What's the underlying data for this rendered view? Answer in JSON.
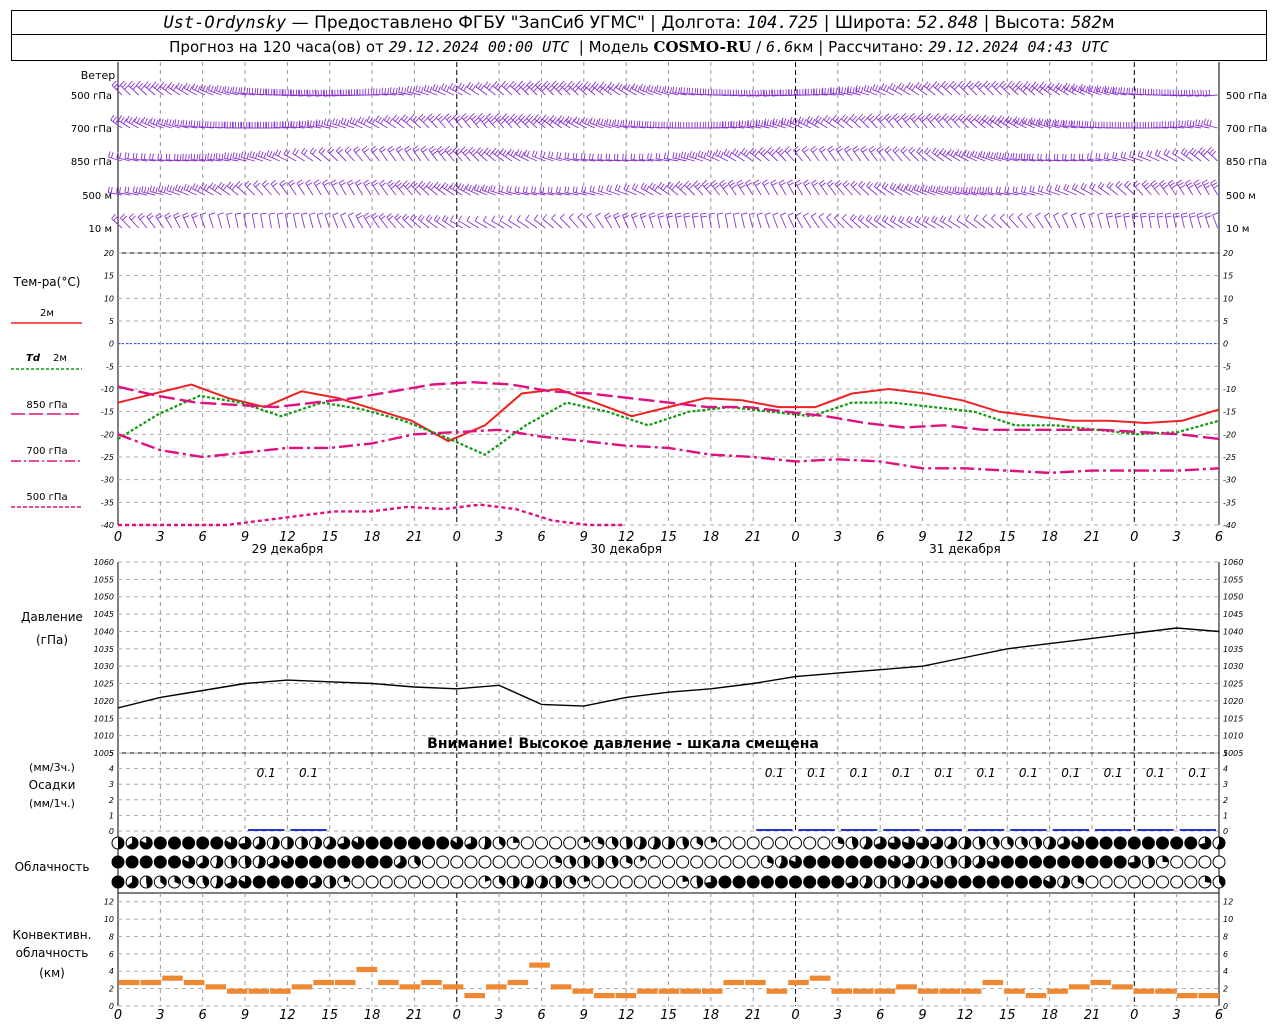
{
  "header": {
    "station": "Ust-Ordynsky",
    "provided_by": "Предоставлено ФГБУ \"ЗапСиб УГМС\"",
    "lon_label": "Долгота:",
    "lon": "104.725",
    "lat_label": "Широта:",
    "lat": "52.848",
    "alt_label": "Высота:",
    "alt": "582",
    "alt_unit": "м",
    "forecast_label": "Прогноз на 120 часа(ов) от",
    "forecast_time": "29.12.2024 00:00 UTC",
    "model_label": "Модель",
    "model": "COSMO-RU",
    "resolution": "6.6",
    "resolution_unit": "км",
    "computed_label": "Рассчитано:",
    "computed_time": "29.12.2024 04:43 UTC"
  },
  "labels": {
    "wind": "Ветер",
    "wind_levels": [
      "500 гПа",
      "700 гПа",
      "850 гПа",
      "500 м",
      "10  м"
    ],
    "temp_title": "Тем-ра(°С)",
    "t2m": "2м",
    "td_sym": "Td",
    "td2m": "2м",
    "t850": "850 гПа",
    "t700": "700 гПа",
    "t500": "500 гПа",
    "pressure": "Давление",
    "pressure_unit": "(гПа)",
    "pressure_warning": "Внимание! Высокое давление - шкала смещена",
    "precip_unit3": "(мм/3ч.)",
    "precip": "Осадки",
    "precip_unit1": "(мм/1ч.)",
    "cloud": "Облачность",
    "conv1": "Конвективн.",
    "conv2": "облачность",
    "conv3": "(км)"
  },
  "colors": {
    "t2m": "#ee2222",
    "td2m": "#119911",
    "upper_temp": "#e01080",
    "zero_line": "#3344ff",
    "wind": "#8833cc",
    "precip": "#2233cc",
    "convective": "#ee8833"
  },
  "chart_data": {
    "type": "line",
    "x_hours_from_start": [
      0,
      3,
      6,
      9,
      12,
      15,
      18,
      21,
      24,
      27,
      30,
      33,
      36,
      39,
      42,
      45,
      48,
      51,
      54,
      57,
      60,
      63,
      66,
      69,
      72,
      75,
      78
    ],
    "x_tick_labels": [
      "0",
      "3",
      "6",
      "9",
      "12",
      "15",
      "18",
      "21",
      "0",
      "3",
      "6",
      "9",
      "12",
      "15",
      "18",
      "21",
      "0",
      "3",
      "6",
      "9",
      "12",
      "15",
      "18",
      "21",
      "0",
      "3",
      "6"
    ],
    "date_labels": [
      "29 декабря",
      "30 декабря",
      "31 декабря"
    ],
    "temperature": {
      "ylim": [
        -40,
        20
      ],
      "yticks": [
        20,
        15,
        10,
        5,
        0,
        -5,
        -10,
        -15,
        -20,
        -25,
        -30,
        -35,
        -40
      ],
      "series": [
        {
          "name": "2м",
          "values": [
            -13,
            -11,
            -9,
            -12,
            -14,
            -10.5,
            -12,
            -14.5,
            -17,
            -21.5,
            -18,
            -11,
            -10,
            -13,
            -16,
            -14,
            -12,
            -12.5,
            -14,
            -14,
            -11,
            -10,
            -11,
            -12.5,
            -15,
            -16,
            -17,
            -17,
            -17.5,
            -17,
            -14.5
          ]
        },
        {
          "name": "Td 2м",
          "values": [
            -21,
            -15.5,
            -11.5,
            -13,
            -16,
            -13,
            -14.5,
            -17,
            -20.5,
            -24.5,
            -18,
            -13,
            -15,
            -18,
            -15,
            -14,
            -15,
            -16,
            -13,
            -13,
            -14,
            -15,
            -18,
            -18,
            -19,
            -20,
            -19.5,
            -17
          ]
        },
        {
          "name": "850 гПа",
          "values": [
            -9.5,
            -11.5,
            -13,
            -13.5,
            -14,
            -13,
            -12,
            -10.5,
            -9,
            -8.5,
            -9,
            -10.5,
            -11,
            -12,
            -13,
            -14,
            -14,
            -15,
            -16,
            -17.5,
            -18.5,
            -18,
            -19,
            -19,
            -19,
            -19,
            -19.5,
            -20,
            -21
          ]
        },
        {
          "name": "700 гПа",
          "values": [
            -20,
            -23.5,
            -25,
            -24,
            -23,
            -23,
            -22,
            -20,
            -19.5,
            -19,
            -20.5,
            -21.5,
            -22.5,
            -23,
            -24.5,
            -25,
            -26,
            -25.5,
            -26,
            -27.5,
            -27.5,
            -28,
            -28.5,
            -28,
            -28,
            -28,
            -27.5
          ]
        },
        {
          "name": "500 гПа",
          "values": [
            -40,
            -40.5,
            -41,
            -40,
            -39,
            -38,
            -37,
            -37,
            -36,
            -36.5,
            -35.5,
            -36.5,
            -39,
            -40,
            -41
          ]
        }
      ]
    },
    "pressure": {
      "ylim": [
        1005,
        1060
      ],
      "yticks": [
        1060,
        1055,
        1050,
        1045,
        1040,
        1035,
        1030,
        1025,
        1020,
        1015,
        1010,
        1005
      ],
      "values": [
        1018,
        1021,
        1023,
        1025,
        1026,
        1025.5,
        1025,
        1024,
        1023.5,
        1024.5,
        1019,
        1018.5,
        1021,
        1022.5,
        1023.5,
        1025,
        1027,
        1028,
        1029,
        1030,
        1032.5,
        1035,
        1036.5,
        1038,
        1039.5,
        1041,
        1040
      ]
    },
    "precipitation": {
      "ylim": [
        0,
        5
      ],
      "yticks": [
        5,
        4,
        3,
        2,
        1,
        0
      ],
      "labels_3h": [
        {
          "hour": 12,
          "value": "0.1"
        },
        {
          "hour": 15,
          "value": "0.1"
        },
        {
          "hour": 48,
          "value": "0.1"
        },
        {
          "hour": 51,
          "value": "0.1"
        },
        {
          "hour": 54,
          "value": "0.1"
        },
        {
          "hour": 57,
          "value": "0.1"
        },
        {
          "hour": 60,
          "value": "0.1"
        },
        {
          "hour": 63,
          "value": "0.1"
        },
        {
          "hour": 66,
          "value": "0.1"
        },
        {
          "hour": 69,
          "value": "0.1"
        },
        {
          "hour": 72,
          "value": "0.1"
        },
        {
          "hour": 75,
          "value": "0.1"
        },
        {
          "hour": 78,
          "value": "0.1"
        }
      ]
    },
    "convective": {
      "ylim": [
        0,
        13
      ],
      "yticks": [
        12,
        10,
        8,
        6,
        4,
        2,
        0
      ],
      "values": [
        3,
        3,
        3.5,
        3,
        2.5,
        2,
        2,
        2,
        2.5,
        3,
        3,
        4.5,
        3,
        2.5,
        3,
        2.5,
        1.5,
        2.5,
        3,
        5,
        2.5,
        2,
        1.5,
        1.5,
        2,
        2,
        2,
        2,
        3,
        3,
        2,
        3,
        3.5,
        2,
        2,
        2,
        2.5,
        2,
        2,
        2,
        3,
        2,
        1.5,
        2,
        2.5,
        3,
        2.5,
        2,
        2,
        1.5,
        1.5
      ]
    }
  }
}
